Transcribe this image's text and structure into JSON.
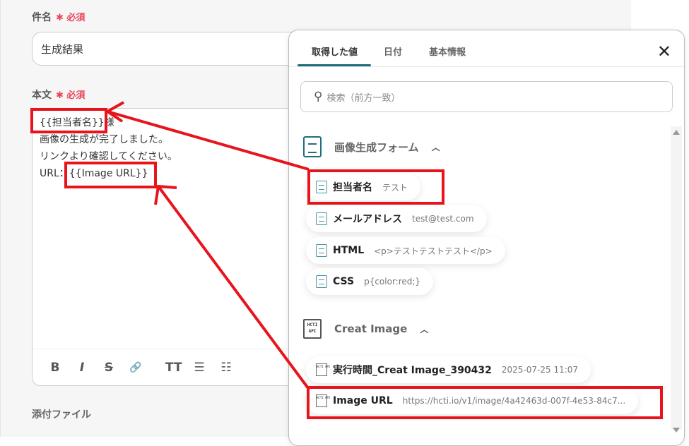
{
  "form": {
    "subject_label": "件名",
    "required": "必須",
    "subject_value": "生成結果",
    "body_label": "本文",
    "body_lines": [
      "{{担当者名}}様",
      "画像の生成が完了しました。",
      "リンクより確認してください。",
      "URL：{{Image URL}}"
    ],
    "toolbar": [
      "B",
      "I",
      "S",
      "🔗",
      "TT",
      "☰",
      "☷"
    ],
    "attach_label": "添付ファイル"
  },
  "popup": {
    "tabs": [
      "取得した値",
      "日付",
      "基本情報"
    ],
    "search_placeholder": "検索（前方一致）",
    "groups": [
      {
        "title": "画像生成フォーム",
        "icon": "form-icon",
        "items": [
          {
            "name": "担当者名",
            "value": "テスト"
          },
          {
            "name": "メールアドレス",
            "value": "test@test.com"
          },
          {
            "name": "HTML",
            "value": "<p>テストテストテスト</p>"
          },
          {
            "name": "CSS",
            "value": "p{color:red;}"
          }
        ]
      },
      {
        "title": "Creat Image",
        "icon": "hcti-api-icon",
        "icon_text": "HCTI API",
        "items": [
          {
            "name": "実行時間_Creat Image_390432",
            "value": "2025-07-25 11:07"
          },
          {
            "name": "Image URL",
            "value": "https://hcti.io/v1/image/4a42463d-007f-4e53-84c7..."
          }
        ]
      }
    ]
  },
  "annotation_color": "#e8141c"
}
